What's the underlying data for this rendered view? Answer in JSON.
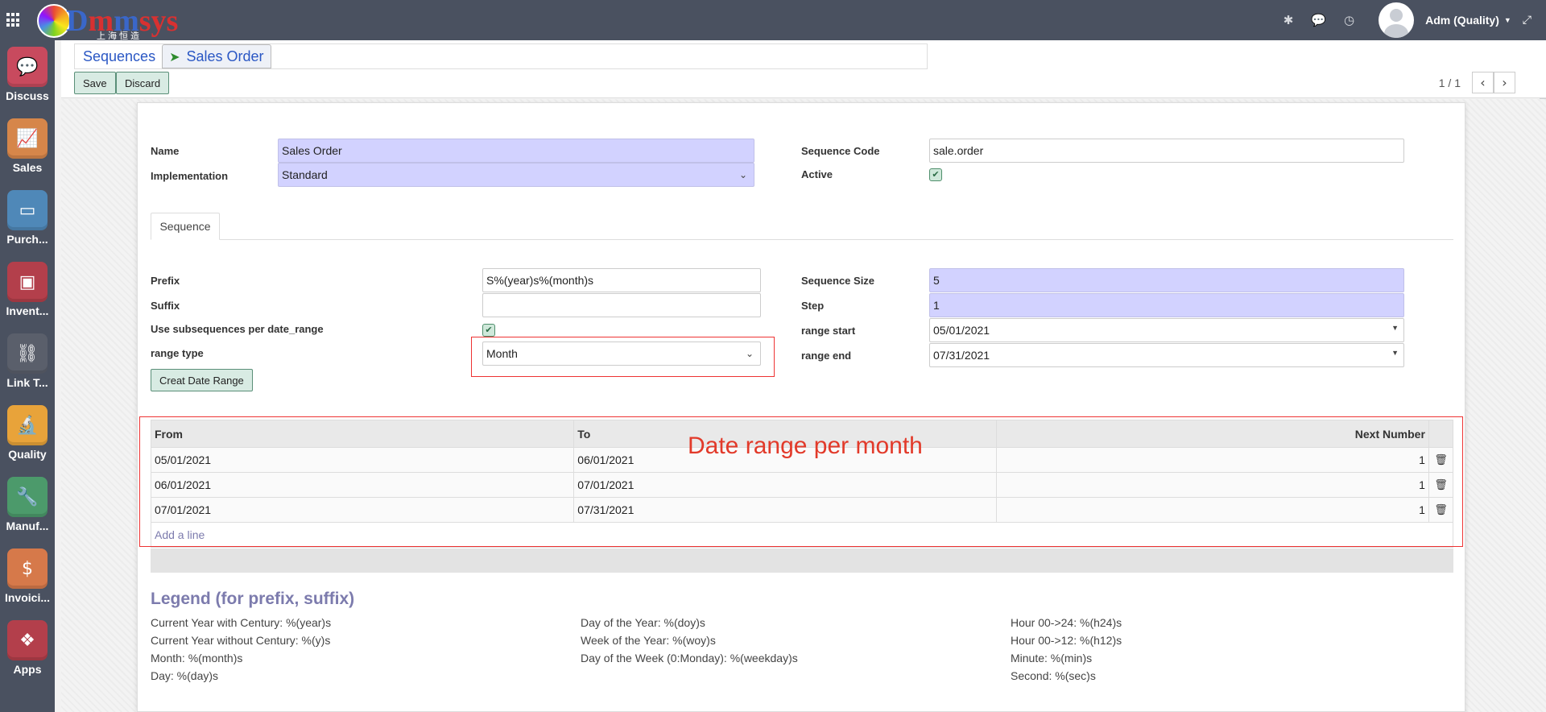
{
  "brand": {
    "logo_text_a": "D",
    "logo_text_b": "m",
    "logo_text_c": "m",
    "logo_text_d": "sys",
    "logo_sub": "上海恒造"
  },
  "topbar": {
    "user": "Adm (Quality)"
  },
  "sidebar": {
    "items": [
      {
        "label": "Discuss",
        "color": "#c84a5e",
        "icon": "chat-bubble-icon"
      },
      {
        "label": "Sales",
        "color": "#d6864a",
        "icon": "sales-chart-icon"
      },
      {
        "label": "Purch...",
        "color": "#4f88b8",
        "icon": "credit-card-icon"
      },
      {
        "label": "Invent...",
        "color": "#b33f4b",
        "icon": "inventory-box-icon"
      },
      {
        "label": "Link T...",
        "color": "#5a5f6b",
        "icon": "chain-link-icon"
      },
      {
        "label": "Quality",
        "color": "#e8a33a",
        "icon": "microscope-icon"
      },
      {
        "label": "Manuf...",
        "color": "#4c9a6b",
        "icon": "wrench-icon"
      },
      {
        "label": "Invoici...",
        "color": "#d6794a",
        "icon": "invoice-dollar-icon"
      },
      {
        "label": "Apps",
        "color": "#b33f4b",
        "icon": "apps-cubes-icon"
      }
    ]
  },
  "breadcrumb": {
    "parent": "Sequences",
    "current": "Sales Order"
  },
  "toolbar": {
    "save": "Save",
    "discard": "Discard"
  },
  "pager": {
    "value": "1 / 1"
  },
  "form": {
    "name_label": "Name",
    "name_value": "Sales Order",
    "impl_label": "Implementation",
    "impl_value": "Standard",
    "code_label": "Sequence Code",
    "code_value": "sale.order",
    "active_label": "Active",
    "active_checked": true,
    "tab_label": "Sequence",
    "prefix_label": "Prefix",
    "prefix_value": "S%(year)s%(month)s",
    "suffix_label": "Suffix",
    "suffix_value": "",
    "use_sub_label": "Use subsequences per date_range",
    "use_sub_checked": true,
    "range_type_label": "range type",
    "range_type_value": "Month",
    "create_range_button": "Creat Date Range",
    "size_label": "Sequence Size",
    "size_value": "5",
    "step_label": "Step",
    "step_value": "1",
    "range_start_label": "range start",
    "range_start_value": "05/01/2021",
    "range_end_label": "range end",
    "range_end_value": "07/31/2021"
  },
  "annotation": "Date range per month",
  "date_ranges": {
    "headers": {
      "from": "From",
      "to": "To",
      "next": "Next Number"
    },
    "rows": [
      {
        "from": "05/01/2021",
        "to": "06/01/2021",
        "next": "1"
      },
      {
        "from": "06/01/2021",
        "to": "07/01/2021",
        "next": "1"
      },
      {
        "from": "07/01/2021",
        "to": "07/31/2021",
        "next": "1"
      }
    ],
    "add_line": "Add a line"
  },
  "legend": {
    "title": "Legend (for prefix, suffix)",
    "col1": [
      "Current Year with Century: %(year)s",
      "Current Year without Century: %(y)s",
      "Month: %(month)s",
      "Day: %(day)s"
    ],
    "col2": [
      "Day of the Year: %(doy)s",
      "Week of the Year: %(woy)s",
      "Day of the Week (0:Monday): %(weekday)s"
    ],
    "col3": [
      "Hour 00->24: %(h24)s",
      "Hour 00->12: %(h12)s",
      "Minute: %(min)s",
      "Second: %(sec)s"
    ]
  }
}
